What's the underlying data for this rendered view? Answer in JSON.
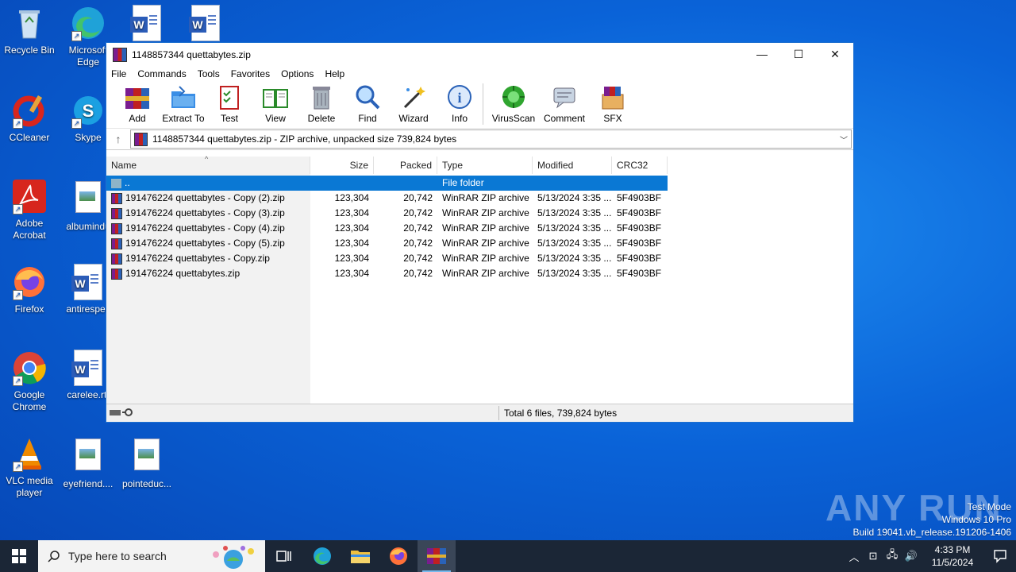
{
  "desktop": {
    "icons": [
      {
        "label": "Recycle Bin",
        "type": "recycle"
      },
      {
        "label": "Microsoft Edge",
        "type": "edge"
      },
      {
        "label": "CCleaner",
        "type": "ccleaner"
      },
      {
        "label": "Skype",
        "type": "skype"
      },
      {
        "label": "Adobe Acrobat",
        "type": "acrobat"
      },
      {
        "label": "albumindu",
        "type": "image"
      },
      {
        "label": "Firefox",
        "type": "firefox"
      },
      {
        "label": "antirespec",
        "type": "word"
      },
      {
        "label": "Google Chrome",
        "type": "chrome"
      },
      {
        "label": "carelee.rtf",
        "type": "word"
      },
      {
        "label": "VLC media player",
        "type": "vlc"
      },
      {
        "label": "eyefriend....",
        "type": "image"
      },
      {
        "label": "pointeduc...",
        "type": "image"
      }
    ]
  },
  "window": {
    "title": "1148857344 quettabytes.zip",
    "controls": {
      "minimize": "—",
      "maximize": "☐",
      "close": "✕"
    },
    "menu": [
      "File",
      "Commands",
      "Tools",
      "Favorites",
      "Options",
      "Help"
    ],
    "toolbar": [
      "Add",
      "Extract To",
      "Test",
      "View",
      "Delete",
      "Find",
      "Wizard",
      "Info",
      "VirusScan",
      "Comment",
      "SFX"
    ],
    "address": "1148857344 quettabytes.zip - ZIP archive, unpacked size 739,824 bytes",
    "columns": {
      "name": "Name",
      "size": "Size",
      "packed": "Packed",
      "type": "Type",
      "modified": "Modified",
      "crc": "CRC32"
    },
    "parent_row": {
      "name": "..",
      "type": "File folder"
    },
    "files": [
      {
        "name": "191476224 quettabytes - Copy (2).zip",
        "size": "123,304",
        "packed": "20,742",
        "type": "WinRAR ZIP archive",
        "modified": "5/13/2024 3:35 ...",
        "crc": "5F4903BF"
      },
      {
        "name": "191476224 quettabytes - Copy (3).zip",
        "size": "123,304",
        "packed": "20,742",
        "type": "WinRAR ZIP archive",
        "modified": "5/13/2024 3:35 ...",
        "crc": "5F4903BF"
      },
      {
        "name": "191476224 quettabytes - Copy (4).zip",
        "size": "123,304",
        "packed": "20,742",
        "type": "WinRAR ZIP archive",
        "modified": "5/13/2024 3:35 ...",
        "crc": "5F4903BF"
      },
      {
        "name": "191476224 quettabytes - Copy (5).zip",
        "size": "123,304",
        "packed": "20,742",
        "type": "WinRAR ZIP archive",
        "modified": "5/13/2024 3:35 ...",
        "crc": "5F4903BF"
      },
      {
        "name": "191476224 quettabytes - Copy.zip",
        "size": "123,304",
        "packed": "20,742",
        "type": "WinRAR ZIP archive",
        "modified": "5/13/2024 3:35 ...",
        "crc": "5F4903BF"
      },
      {
        "name": "191476224 quettabytes.zip",
        "size": "123,304",
        "packed": "20,742",
        "type": "WinRAR ZIP archive",
        "modified": "5/13/2024 3:35 ...",
        "crc": "5F4903BF"
      }
    ],
    "status": "Total 6 files, 739,824 bytes"
  },
  "taskbar": {
    "search_placeholder": "Type here to search",
    "time": "4:33 PM",
    "date": "11/5/2024"
  },
  "watermark": {
    "brand": "ANY RUN",
    "line1": "Test Mode",
    "line2": "Windows 10 Pro",
    "line3": "Build 19041.vb_release.191206-1406"
  }
}
